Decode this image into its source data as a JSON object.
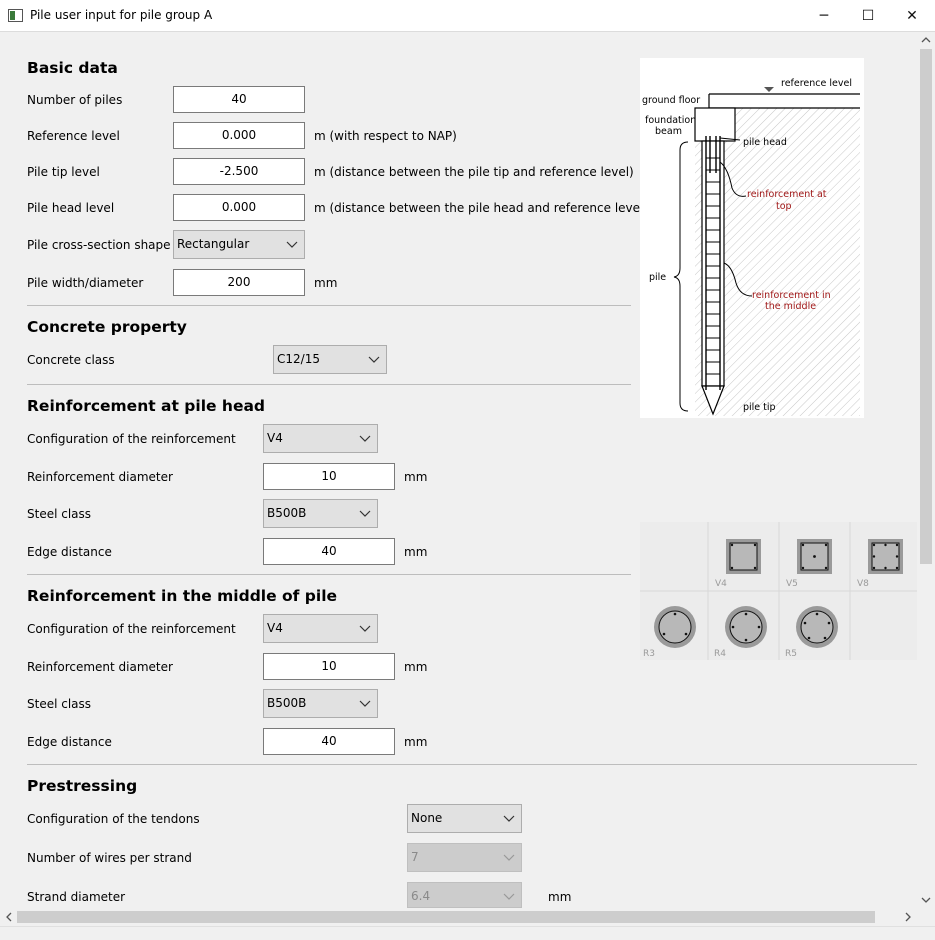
{
  "window": {
    "title": "Pile user input for pile group A",
    "minimize_glyph": "─",
    "maximize_glyph": "☐",
    "close_glyph": "✕"
  },
  "basic": {
    "heading": "Basic data",
    "num_piles_label": "Number of piles",
    "num_piles_value": "40",
    "ref_level_label": "Reference level",
    "ref_level_value": "0.000",
    "ref_level_unit": "m (with respect to NAP)",
    "tip_level_label": "Pile tip level",
    "tip_level_value": "-2.500",
    "tip_level_unit": "m (distance between the pile tip and reference level)",
    "head_level_label": "Pile head level",
    "head_level_value": "0.000",
    "head_level_unit": "m (distance between the pile head and reference level)",
    "shape_label": "Pile cross-section shape",
    "shape_value": "Rectangular",
    "width_label": "Pile width/diameter",
    "width_value": "200",
    "width_unit": "mm"
  },
  "concrete": {
    "heading": "Concrete property",
    "class_label": "Concrete class",
    "class_value": "C12/15"
  },
  "reinf_head": {
    "heading": "Reinforcement at pile head",
    "config_label": "Configuration of the reinforcement",
    "config_value": "V4",
    "diam_label": "Reinforcement diameter",
    "diam_value": "10",
    "diam_unit": "mm",
    "steel_label": "Steel class",
    "steel_value": "B500B",
    "edge_label": "Edge distance",
    "edge_value": "40",
    "edge_unit": "mm"
  },
  "reinf_mid": {
    "heading": "Reinforcement in the middle of pile",
    "config_label": "Configuration of the reinforcement",
    "config_value": "V4",
    "diam_label": "Reinforcement diameter",
    "diam_value": "10",
    "diam_unit": "mm",
    "steel_label": "Steel class",
    "steel_value": "B500B",
    "edge_label": "Edge distance",
    "edge_value": "40",
    "edge_unit": "mm"
  },
  "prestress": {
    "heading": "Prestressing",
    "tendon_label": "Configuration of the tendons",
    "tendon_value": "None",
    "wires_label": "Number of wires per strand",
    "wires_value": "7",
    "strand_label": "Strand diameter",
    "strand_value": "6.4",
    "strand_unit": "mm"
  },
  "diagram": {
    "reference_level": "reference level",
    "ground_floor": "ground floor",
    "foundation_line1": "foundation",
    "foundation_line2": "beam",
    "pile_head": "pile head",
    "reinf_top_line1": "reinforcement at",
    "reinf_top_line2": "top",
    "pile": "pile",
    "reinf_mid_line1": "reinforcement in",
    "reinf_mid_line2": "the middle",
    "pile_tip": "pile tip",
    "accent_color": "#a01818"
  },
  "configs": {
    "v4": "V4",
    "v5": "V5",
    "v8": "V8",
    "r3": "R3",
    "r4": "R4",
    "r5": "R5"
  }
}
